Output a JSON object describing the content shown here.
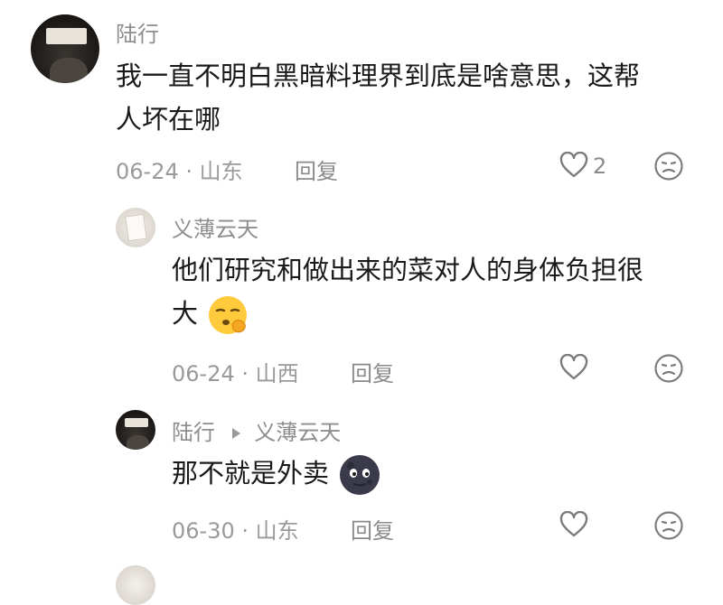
{
  "comments": [
    {
      "author": "陆行",
      "text_line1": "我一直不明白黑暗料理界到底是啥意思，这帮",
      "text_line2": "人坏在哪",
      "date_location": "06-24 · 山东",
      "reply_label": "回复",
      "like_count": "2"
    },
    {
      "author": "义薄云天",
      "text_line1": "他们研究和做出来的菜对人的身体负担很",
      "text_line2": "大",
      "emoji": "shushing-face",
      "date_location": "06-24 · 山西",
      "reply_label": "回复"
    },
    {
      "author": "陆行",
      "reply_to": "义薄云天",
      "text": "那不就是外卖",
      "emoji": "new-moon-face",
      "date_location": "06-30 · 山东",
      "reply_label": "回复"
    }
  ],
  "colors": {
    "name": "#8e8e8e",
    "text": "#1a1a1a",
    "meta": "#9a9a9a"
  },
  "icons": [
    "heart-outline-icon",
    "sad-face-icon",
    "reply-arrow-icon"
  ]
}
